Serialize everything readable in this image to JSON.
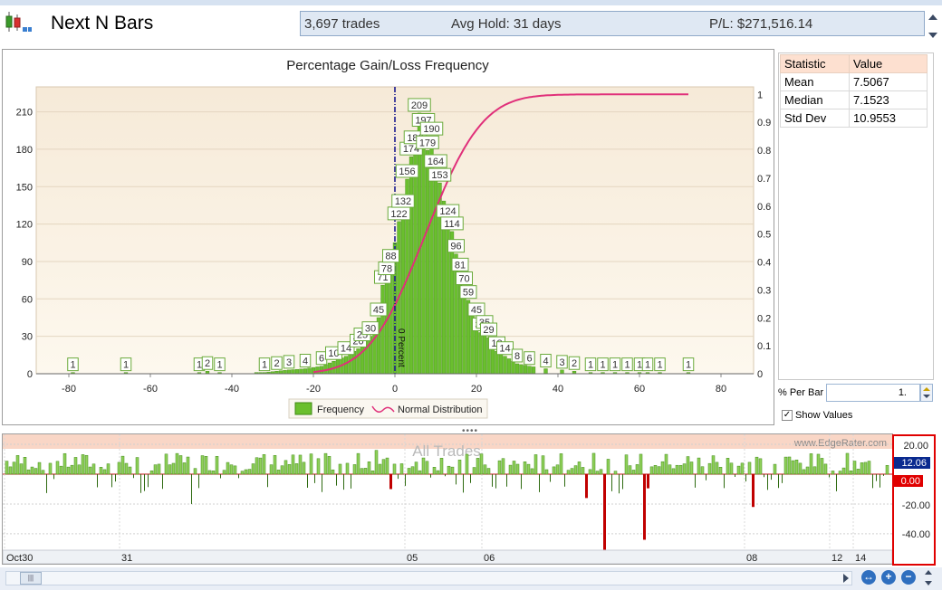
{
  "app": {
    "title": "Next N Bars",
    "summary": {
      "trades": "3,697 trades",
      "avg_hold": "Avg Hold: 31 days",
      "pl": "P/L: $271,516.14"
    }
  },
  "stats": {
    "headers": [
      "Statistic",
      "Value"
    ],
    "rows": [
      {
        "name": "Mean",
        "value": "7.5067"
      },
      {
        "name": "Median",
        "value": "7.1523"
      },
      {
        "name": "Std Dev",
        "value": "10.9553"
      }
    ]
  },
  "controls": {
    "pct_per_bar_label": "% Per Bar",
    "pct_per_bar_value": "1.",
    "show_values_label": "Show Values",
    "show_values_checked": "✓"
  },
  "colors": {
    "bar": "#6abf2e",
    "bar_dark": "#3f8a14",
    "normal": "#e0307a",
    "zero_line": "#1b1b8f",
    "pos_bar": "#8fd05a",
    "neg_bar": "#c00000",
    "value_pos": "#0a2a8f",
    "value_neg": "#e00000"
  },
  "chart_data": [
    {
      "type": "bar",
      "title": "Percentage Gain/Loss Frequency",
      "xlim": [
        -88,
        88
      ],
      "ylim": [
        0,
        230
      ],
      "y2lim": [
        0,
        1
      ],
      "x_ticks": [
        -80,
        -60,
        -40,
        -20,
        0,
        20,
        40,
        60,
        80
      ],
      "y_ticks": [
        0,
        30,
        60,
        90,
        120,
        150,
        180,
        210
      ],
      "y2_ticks": [
        0,
        0.1,
        0.2,
        0.3,
        0.4,
        0.5,
        0.6,
        0.7,
        0.8,
        0.9,
        1
      ],
      "zero_line_label": "0 Percent",
      "legend": [
        "Frequency",
        "Normal Distribution"
      ],
      "labeled_bars": [
        {
          "x": -79,
          "y": 1
        },
        {
          "x": -66,
          "y": 1
        },
        {
          "x": -48,
          "y": 1
        },
        {
          "x": -46,
          "y": 2
        },
        {
          "x": -43,
          "y": 1
        },
        {
          "x": -32,
          "y": 1
        },
        {
          "x": -29,
          "y": 2
        },
        {
          "x": -26,
          "y": 3
        },
        {
          "x": -22,
          "y": 4
        },
        {
          "x": -18,
          "y": 6
        },
        {
          "x": -15,
          "y": 10
        },
        {
          "x": -12,
          "y": 14
        },
        {
          "x": -9,
          "y": 20
        },
        {
          "x": -8,
          "y": 25
        },
        {
          "x": -6,
          "y": 30
        },
        {
          "x": -4,
          "y": 45
        },
        {
          "x": -3,
          "y": 71
        },
        {
          "x": -2,
          "y": 78
        },
        {
          "x": -1,
          "y": 88
        },
        {
          "x": 1,
          "y": 122
        },
        {
          "x": 2,
          "y": 132
        },
        {
          "x": 3,
          "y": 156
        },
        {
          "x": 4,
          "y": 174
        },
        {
          "x": 5,
          "y": 183
        },
        {
          "x": 6,
          "y": 209
        },
        {
          "x": 7,
          "y": 197
        },
        {
          "x": 8,
          "y": 179
        },
        {
          "x": 9,
          "y": 190
        },
        {
          "x": 10,
          "y": 164
        },
        {
          "x": 11,
          "y": 153
        },
        {
          "x": 13,
          "y": 124
        },
        {
          "x": 14,
          "y": 114
        },
        {
          "x": 15,
          "y": 96
        },
        {
          "x": 16,
          "y": 81
        },
        {
          "x": 17,
          "y": 70
        },
        {
          "x": 18,
          "y": 59
        },
        {
          "x": 20,
          "y": 45
        },
        {
          "x": 21,
          "y": 33
        },
        {
          "x": 22,
          "y": 35
        },
        {
          "x": 23,
          "y": 29
        },
        {
          "x": 25,
          "y": 18
        },
        {
          "x": 27,
          "y": 14
        },
        {
          "x": 30,
          "y": 8
        },
        {
          "x": 33,
          "y": 6
        },
        {
          "x": 37,
          "y": 4
        },
        {
          "x": 41,
          "y": 3
        },
        {
          "x": 44,
          "y": 2
        },
        {
          "x": 48,
          "y": 1
        },
        {
          "x": 51,
          "y": 1
        },
        {
          "x": 54,
          "y": 1
        },
        {
          "x": 57,
          "y": 1
        },
        {
          "x": 60,
          "y": 1
        },
        {
          "x": 62,
          "y": 1
        },
        {
          "x": 65,
          "y": 1
        },
        {
          "x": 72,
          "y": 1
        }
      ]
    },
    {
      "type": "bar",
      "title": "All Trades",
      "watermark": "www.EdgeRater.com",
      "ylim": [
        -50,
        25
      ],
      "y_ticks": [
        "20.00",
        "-20.00",
        "-40.00"
      ],
      "current_value": "12.06",
      "zero_value": "0.00",
      "x_labels": [
        "Oct30",
        "31",
        "05",
        "06",
        "08",
        "12",
        "14"
      ]
    }
  ]
}
